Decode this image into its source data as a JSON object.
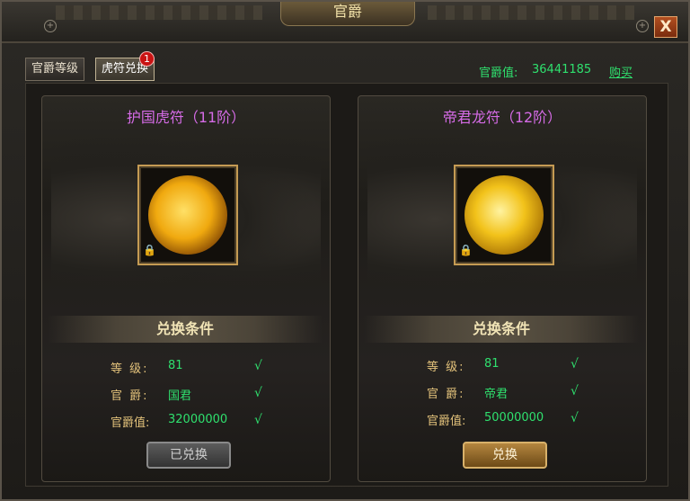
{
  "window": {
    "title": "官爵",
    "close_label": "X"
  },
  "tabs": [
    {
      "label": "官爵等级",
      "active": false
    },
    {
      "label": "虎符兑换",
      "active": true,
      "badge": "1"
    }
  ],
  "header": {
    "rank_value_label": "官爵值:",
    "rank_value": "36441185",
    "buy_label": "购买"
  },
  "cards": [
    {
      "title": "护国虎符（11阶）",
      "conditions_title": "兑换条件",
      "conditions": [
        {
          "label": "等  级:",
          "value": "81"
        },
        {
          "label": "官  爵:",
          "value": "国君"
        },
        {
          "label": "官爵值:",
          "value": "32000000"
        }
      ],
      "button_label": "已兑换",
      "button_state": "disabled"
    },
    {
      "title": "帝君龙符（12阶）",
      "conditions_title": "兑换条件",
      "conditions": [
        {
          "label": "等  级:",
          "value": "81"
        },
        {
          "label": "官  爵:",
          "value": "帝君"
        },
        {
          "label": "官爵值:",
          "value": "50000000"
        }
      ],
      "button_label": "兑换",
      "button_state": "enabled"
    }
  ],
  "icons": {
    "check": "check-icon",
    "lock": "lock-icon",
    "pin": "pin-icon"
  },
  "colors": {
    "green_text": "#2fe06e",
    "purple_title": "#d56be6",
    "gold_label": "#e3c27b"
  }
}
